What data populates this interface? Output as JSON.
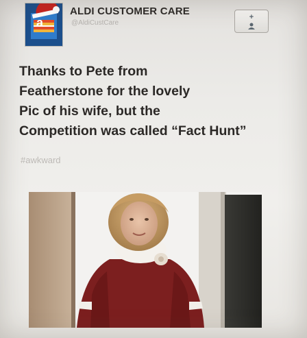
{
  "account": {
    "name": "ALDI CUSTOMER CARE",
    "handle": "@AldiCustCare",
    "avatar_icon": "aldi-logo-santa-hat-icon"
  },
  "follow_button": {
    "label": "+",
    "icon": "person-add-icon"
  },
  "tweet": {
    "lines": [
      "Thanks to Pete from",
      "Featherstone for the lovely",
      "Pic of his wife, but the",
      "Competition was called “Fact Hunt”"
    ],
    "hashtag": "#awkward"
  },
  "photo": {
    "subject": "woman-in-red-sweater-photo"
  },
  "colors": {
    "background": "#ecebe8",
    "text": "#2b2826",
    "muted": "#bdbab6",
    "brand_blue": "#1c4f8c",
    "sweater_red": "#7c1f1f"
  }
}
